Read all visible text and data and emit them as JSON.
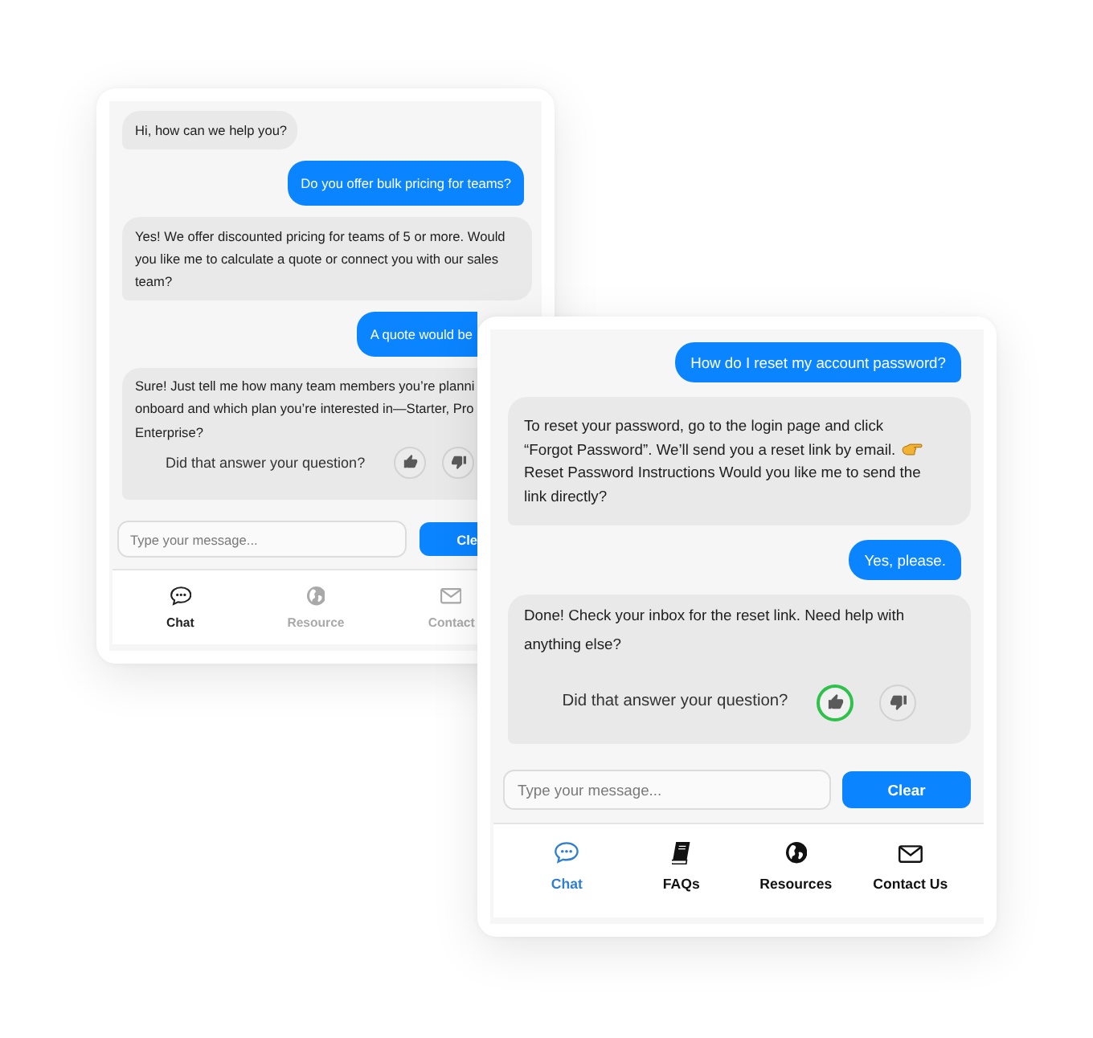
{
  "cards": [
    {
      "kind": "back",
      "messages": [
        {
          "kind": "bot",
          "text": "Hi, how can we help you?"
        },
        {
          "kind": "user",
          "text": "Do you offer bulk pricing for teams?"
        },
        {
          "kind": "bot",
          "text": "Yes! We offer discounted pricing for teams of 5 or more. Would you like me to calculate a quote or connect you with our sales team?"
        },
        {
          "kind": "user",
          "text": "A quote would be"
        },
        {
          "kind": "bot",
          "lines": [
            "Sure! Just tell me how many team members you’re planni",
            "onboard and which plan you’re interested in—Starter, Pro",
            "Enterprise?"
          ],
          "feedback": {
            "prompt": "Did that answer your question?",
            "options": [
              {
                "kind": "up",
                "selected": false
              },
              {
                "kind": "down",
                "selected": false
              }
            ]
          }
        }
      ],
      "input": {
        "placeholder": "Type your message..."
      },
      "button": "Cle",
      "nav": [
        {
          "kind": "chat",
          "label": "Chat",
          "selected": true
        },
        {
          "kind": "globe",
          "label": "Resource",
          "selected": false
        },
        {
          "kind": "mail",
          "label": "Contact",
          "selected": false
        }
      ]
    },
    {
      "kind": "front",
      "messages": [
        {
          "kind": "user",
          "text": "How do I reset my account password?"
        },
        {
          "kind": "bot",
          "parts": [
            {
              "kind": "text",
              "text": "To reset your password, go to the login page and click “Forgot Password”. We’ll send you a reset link by email."
            },
            {
              "kind": "hand"
            },
            {
              "kind": "text",
              "text": "Reset Password Instructions Would you like me to send the link directly?"
            }
          ]
        },
        {
          "kind": "user",
          "text": "Yes, please."
        },
        {
          "kind": "bot",
          "text": "Done! Check your inbox for the reset link. Need help with anything else?",
          "feedback": {
            "prompt": "Did that answer your question?",
            "options": [
              {
                "kind": "up",
                "selected": true
              },
              {
                "kind": "down",
                "selected": false
              }
            ]
          }
        }
      ],
      "input": {
        "placeholder": "Type your message..."
      },
      "button": "Clear",
      "nav": [
        {
          "kind": "chat",
          "label": "Chat",
          "selected": true
        },
        {
          "kind": "book",
          "label": "FAQs",
          "selected": false
        },
        {
          "kind": "globe",
          "label": "Resources",
          "selected": false
        },
        {
          "kind": "mail",
          "label": "Contact Us",
          "selected": false
        }
      ]
    }
  ]
}
